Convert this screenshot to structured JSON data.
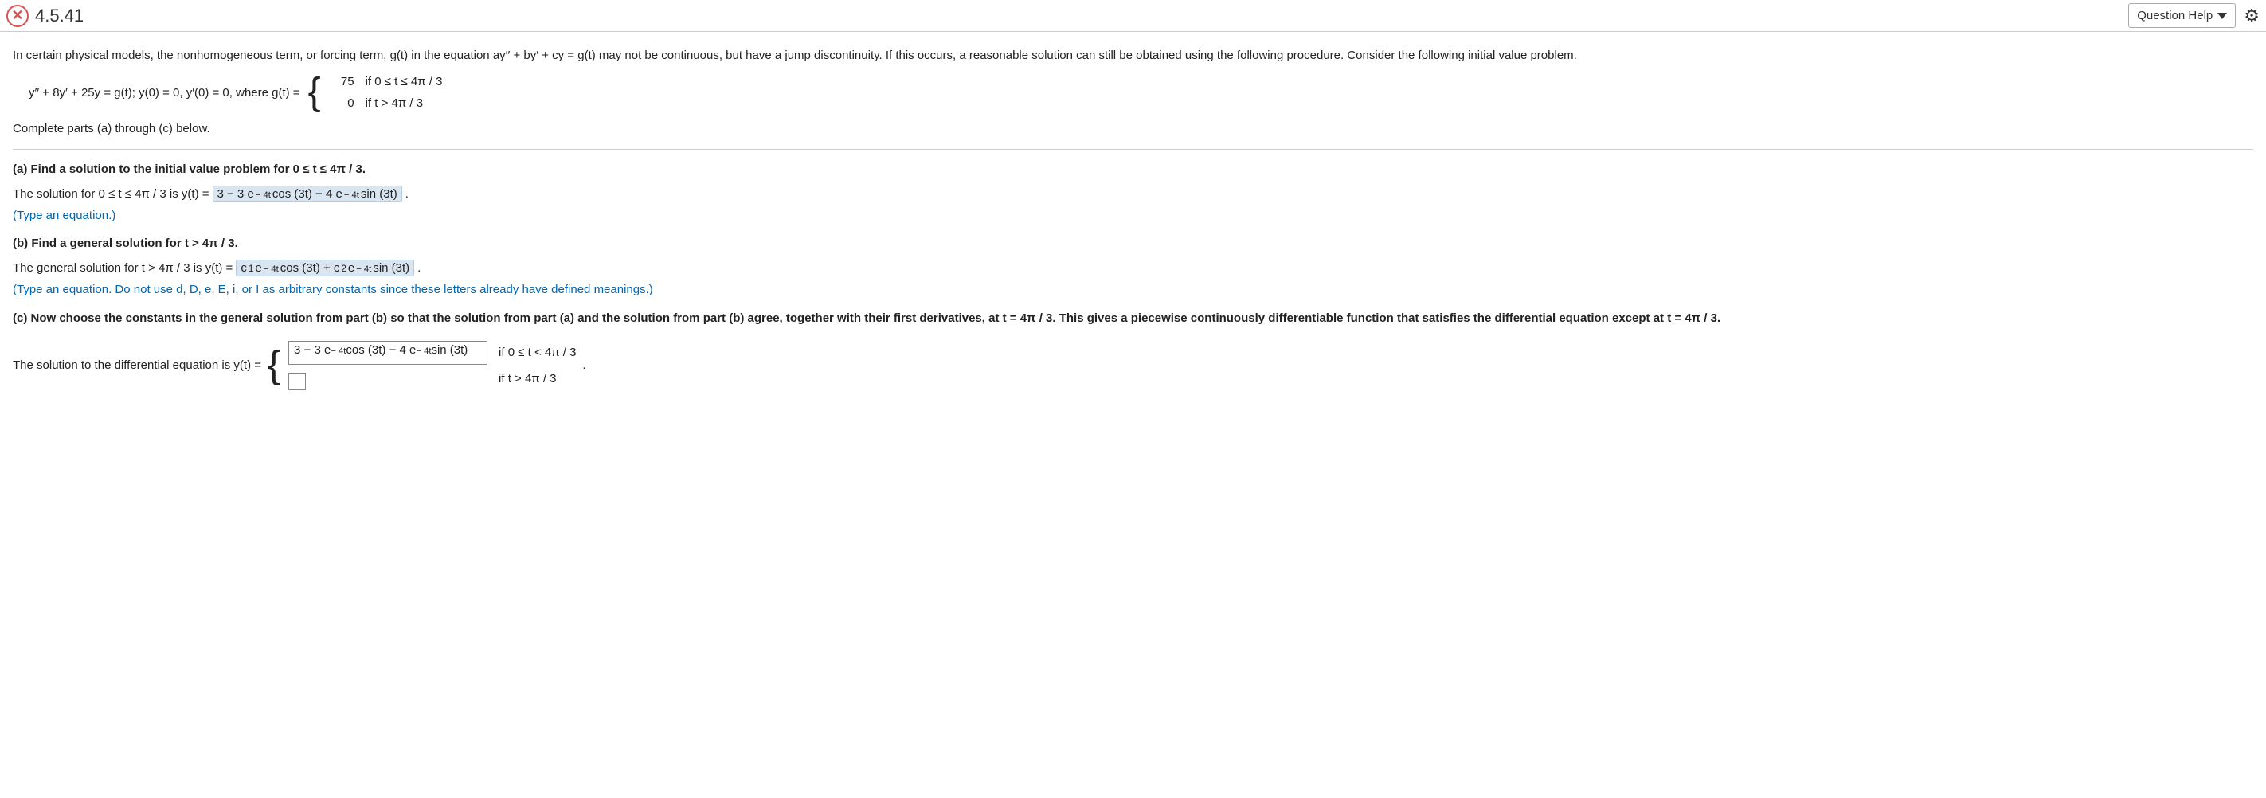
{
  "header": {
    "status_glyph": "✕",
    "question_number": "4.5.41",
    "help_label": "Question Help",
    "gear_glyph": "⚙"
  },
  "intro": "In certain physical models, the nonhomogeneous term, or forcing term, g(t) in the equation ay′′ + by′ + cy = g(t) may not be continuous, but have a jump discontinuity. If this occurs, a reasonable solution can still be obtained using the following procedure. Consider the following initial value problem.",
  "ode": {
    "lhs": "y′′ + 8y′ + 25y = g(t);  y(0) = 0,  y′(0) = 0,  where g(t) =",
    "pieces": [
      {
        "val": "75",
        "cond": "if 0 ≤ t ≤ 4π / 3"
      },
      {
        "val": "0",
        "cond": "if t > 4π / 3"
      }
    ]
  },
  "complete_line": "Complete parts (a) through (c) below.",
  "part_a": {
    "prompt": "(a) Find a solution to the initial value problem for 0 ≤ t ≤ 4π / 3.",
    "lead": "The solution for 0 ≤ t ≤ 4π / 3 is y(t) =",
    "ans_plain1": "3 − 3 e",
    "ans_sup1": "− 4t",
    "ans_plain2": " cos (3t) − 4 e",
    "ans_sup2": "− 4t",
    "ans_plain3": " sin (3t)",
    "trail": " .",
    "hint": "(Type an equation.)"
  },
  "part_b": {
    "prompt": "(b) Find a general solution for t > 4π / 3.",
    "lead": "The general solution for t > 4π / 3 is y(t) =",
    "t1": "c",
    "s1": "1",
    "t2": " e",
    "e1": "− 4t",
    "t3": " cos (3t) + c",
    "s2": "2",
    "t4": " e",
    "e2": "− 4t",
    "t5": " sin (3t)",
    "trail": " .",
    "hint": "(Type an equation. Do not use d, D, e, E, i, or I as arbitrary constants since these letters already have defined meanings.)"
  },
  "part_c": {
    "prompt": "(c) Now choose the constants in the general solution from part (b) so that the solution from part (a) and the solution from part (b) agree, together with their first derivatives, at t = 4π / 3. This gives a piecewise continuously differentiable function that satisfies the differential equation except at t = 4π / 3.",
    "lead": "The solution to the differential equation is y(t) =",
    "row1_p1": "3 − 3 e",
    "row1_s1": "− 4t",
    "row1_p2": " cos (3t) − 4 e",
    "row1_s2": "− 4t",
    "row1_p3": " sin (3t)",
    "cond1": "if 0 ≤ t < 4π / 3",
    "cond2": "if t > 4π / 3",
    "trail": "."
  }
}
